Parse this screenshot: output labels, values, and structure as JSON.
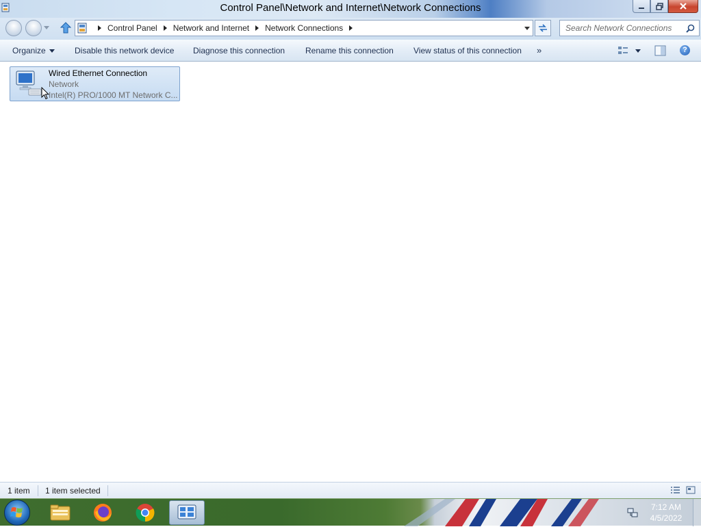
{
  "window": {
    "title": "Control Panel\\Network and Internet\\Network Connections",
    "buttons": {
      "minimize_icon": "minimize-icon",
      "restore_icon": "restore-icon",
      "close_icon": "close-icon"
    }
  },
  "address": {
    "breadcrumbs": [
      "Control Panel",
      "Network and Internet",
      "Network Connections"
    ],
    "search_placeholder": "Search Network Connections"
  },
  "commands": {
    "organize": "Organize",
    "disable": "Disable this network device",
    "diagnose": "Diagnose this connection",
    "rename": "Rename this connection",
    "view_status": "View status of this connection",
    "more": "»"
  },
  "items": [
    {
      "name": "Wired Ethernet Connection",
      "status": "Network",
      "device": "Intel(R) PRO/1000 MT Network C...",
      "selected": true
    }
  ],
  "statusbar": {
    "count": "1 item",
    "selected": "1 item selected"
  },
  "taskbar": {
    "apps": [
      "file-explorer",
      "firefox",
      "chrome",
      "control-panel"
    ],
    "active_app": "control-panel",
    "clock": {
      "time": "7:12 AM",
      "date": "4/5/2022"
    }
  },
  "colors": {
    "command_text": "#1e3050",
    "selection_fill": "#cfe1f5",
    "selection_border": "#7da2ce"
  }
}
